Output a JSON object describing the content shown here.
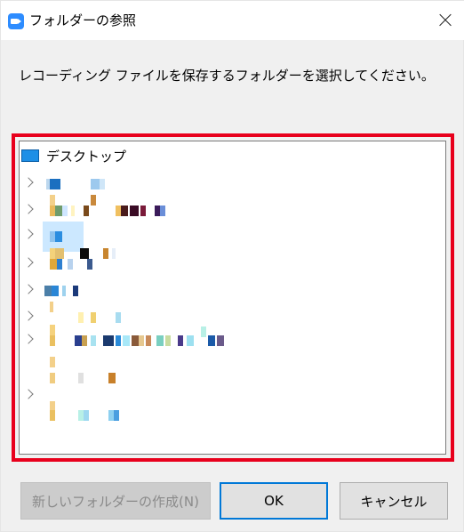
{
  "window": {
    "title": "フォルダーの参照",
    "instruction": "レコーディング ファイルを保存するフォルダーを選択してください。"
  },
  "tree": {
    "root_label": "デスクトップ",
    "items": [
      {
        "expandable": true
      },
      {
        "expandable": true
      },
      {
        "expandable": true,
        "selected": true
      },
      {
        "expandable": true
      },
      {
        "expandable": true
      },
      {
        "expandable": true
      },
      {
        "expandable": true
      },
      {
        "expandable": false
      },
      {
        "expandable": true
      },
      {
        "expandable": false
      }
    ]
  },
  "buttons": {
    "new_folder": "新しいフォルダーの作成(N)",
    "ok": "OK",
    "cancel": "キャンセル"
  },
  "colors": {
    "highlight_border": "#e8001c",
    "selection": "#cce8ff",
    "ok_border": "#0078d7"
  }
}
